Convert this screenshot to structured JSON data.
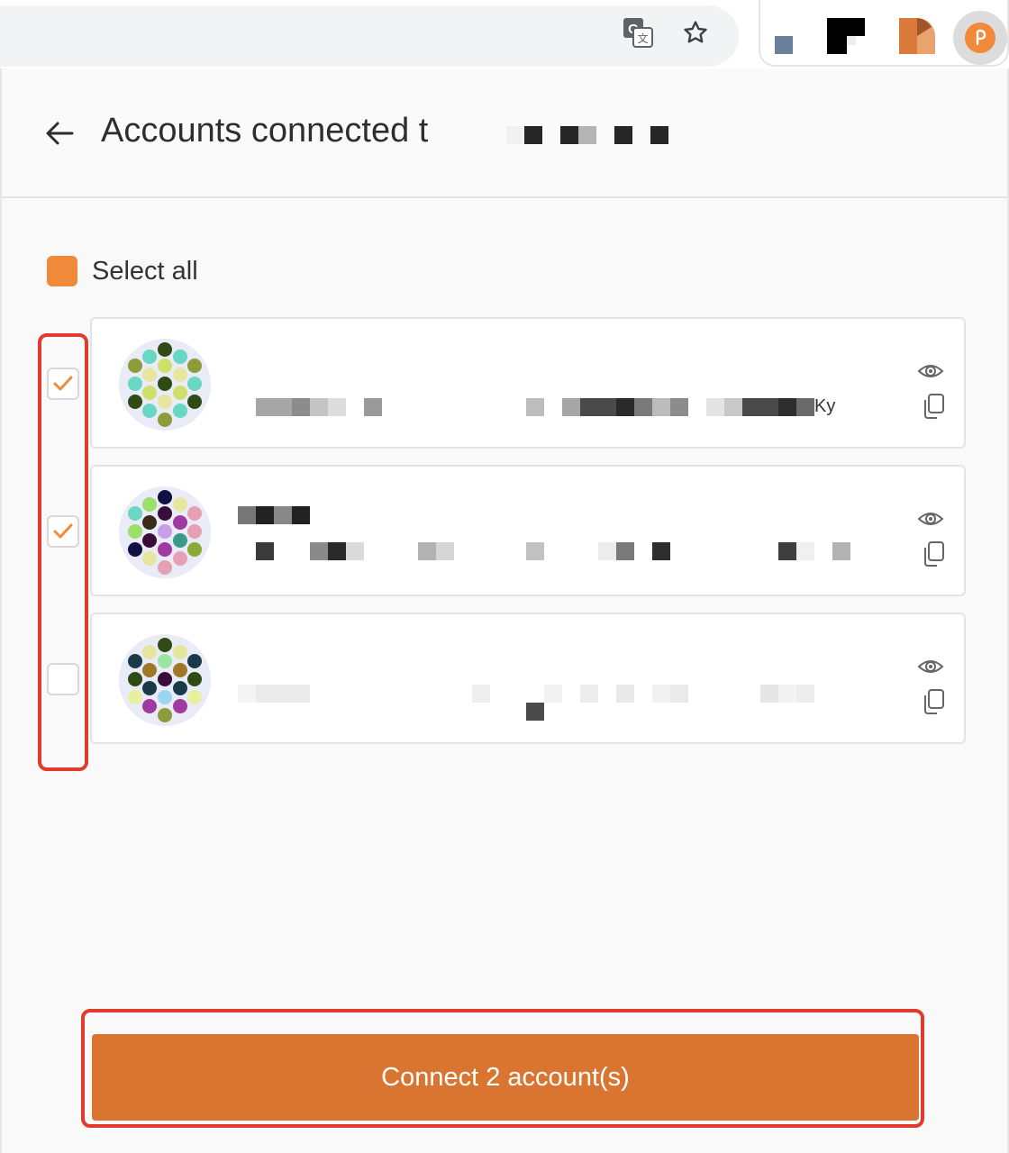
{
  "browser": {
    "icons": [
      "translate-icon",
      "bookmark-star-icon"
    ],
    "extensions": [
      "extension-icon-1",
      "extension-icon-2",
      "extension-icon-3",
      "pinned-extension-icon"
    ]
  },
  "header": {
    "title": "Accounts connected t",
    "back_icon": "back-arrow-icon"
  },
  "select_all": {
    "label": "Select all",
    "state": "partial"
  },
  "accounts": [
    {
      "checked": true,
      "addr_suffix": "Ky",
      "icons": [
        "eye-icon",
        "copy-icon"
      ]
    },
    {
      "checked": true,
      "addr_suffix": "",
      "icons": [
        "eye-icon",
        "copy-icon"
      ]
    },
    {
      "checked": false,
      "addr_suffix": "",
      "icons": [
        "eye-icon",
        "copy-icon"
      ]
    }
  ],
  "footer": {
    "connect_label": "Connect 2 account(s)"
  },
  "colors": {
    "accent": "#f0893a",
    "button": "#d97530",
    "highlight": "#e23b2e"
  }
}
